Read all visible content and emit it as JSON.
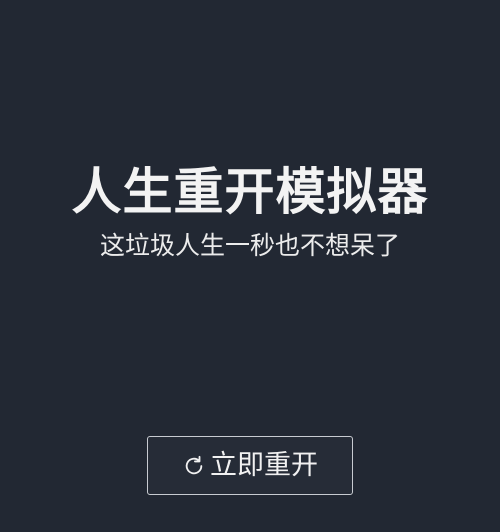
{
  "main": {
    "title": "人生重开模拟器",
    "subtitle": "这垃圾人生一秒也不想呆了"
  },
  "restart_button": {
    "icon": "refresh-icon",
    "label": "立即重开"
  },
  "colors": {
    "background": "#222833",
    "text": "#f3f3f3",
    "button_border": "#c8cbd1"
  }
}
